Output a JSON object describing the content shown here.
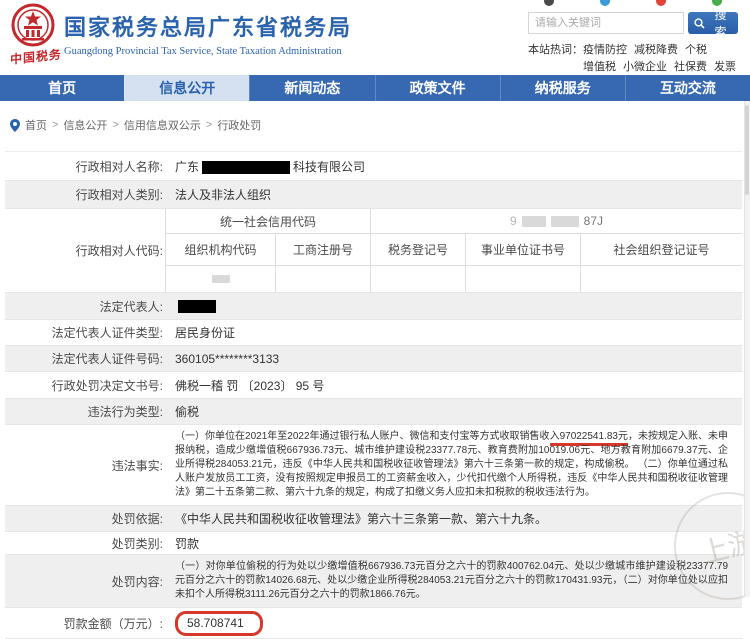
{
  "colors": {
    "brand_blue": "#2a63ad",
    "nav_blue": "#3768b2",
    "nav_active_bg": "#d5e1f0",
    "annotation_red": "#d6382c",
    "row_alt_bg": "#efefef",
    "emblem_red": "#c3282d"
  },
  "header": {
    "logo_text": "中国税务",
    "title": "国家税务总局广东省税务局",
    "subtitle": "Guangdong Provincial Tax Service, State Taxation Administration",
    "search": {
      "placeholder": "请输入关键词",
      "button_label": "搜索"
    },
    "hot_words": {
      "label": "本站热词：",
      "words": [
        "疫情防控",
        "减税降费",
        "个税",
        "增值税",
        "小微企业",
        "社保费",
        "发票"
      ]
    },
    "share_icon_colors": [
      "#4a4a4a",
      "#3a9ad9",
      "#e3443a",
      "#45b04a"
    ]
  },
  "nav": {
    "items": [
      {
        "label": "首页"
      },
      {
        "label": "信息公开",
        "active": true
      },
      {
        "label": "新闻动态"
      },
      {
        "label": "政策文件"
      },
      {
        "label": "纳税服务"
      },
      {
        "label": "互动交流"
      }
    ]
  },
  "breadcrumb": {
    "separator": ">",
    "items": [
      "首页",
      "信息公开",
      "信用信息双公示",
      "行政处罚"
    ]
  },
  "table": {
    "name_label": "行政相对人名称:",
    "name_value_prefix": "广东",
    "name_value_suffix": "科技有限公司",
    "category_label": "行政相对人类别:",
    "category_value": "法人及非法人组织",
    "code_label": "行政相对人代码:",
    "credit_code_label": "统一社会信用代码",
    "credit_code_visible_start": "9",
    "credit_code_visible_end": "87J",
    "code_headers": [
      "组织机构代码",
      "工商注册号",
      "税务登记号",
      "事业单位证书号",
      "社会组织登记证号"
    ],
    "legal_rep_label": "法定代表人:",
    "rep_cert_type_label": "法定代表人证件类型:",
    "rep_cert_type_value": "居民身份证",
    "rep_cert_no_label": "法定代表人证件号码:",
    "rep_cert_no_value": "360105********3133",
    "decision_doc_label": "行政处罚决定文书号:",
    "decision_doc_value": "佛税一稽 罚 〔2023〕 95 号",
    "violation_type_label": "违法行为类型:",
    "violation_type_value": "偷税",
    "facts_label": "违法事实:",
    "facts_before": "（一）你单位在2021年至2022年通过银行私人账户、微信和支付宝等方式收取销售收",
    "facts_highlight": "入97022541.83元",
    "facts_after": "，未按规定入账、未申报纳税，造成少缴增值税667936.73元、城市维护建设税23377.78元、教育费附加10019.06元、地方教育附加6679.37元、企业所得税284053.21元，违反《中华人民共和国税收征收管理法》第六十三条第一款的规定，构成偷税。 （二）你单位通过私人账户发放员工工资，没有按照规定申报员工的工资薪金收入，少代扣代缴个人所得税，违反《中华人民共和国税收征收管理法》第二十五条第二款、第六十九条的规定，构成了扣缴义务人应扣未扣税款的税收违法行为。",
    "basis_label": "处罚依据:",
    "basis_value": "《中华人民共和国税收征收管理法》第六十三条第一款、第六十九条。",
    "penalty_type_label": "处罚类别:",
    "penalty_type_value": "罚款",
    "penalty_content_label": "处罚内容:",
    "penalty_content_value": "（一）对你单位偷税的行为处以少缴增值税667936.73元百分之六十的罚款400762.04元、处以少缴城市维护建设税23377.79元百分之六十的罚款14026.68元、处以少缴企业所得税284053.21元百分之六十的罚款170431.93元，（二）对你单位处以应扣未扣个人所得税3111.26元百分之六十的罚款1866.76元。",
    "fine_amount_label": "罚款金额（万元）:",
    "fine_amount_value": "58.708741"
  },
  "watermark": "上游"
}
